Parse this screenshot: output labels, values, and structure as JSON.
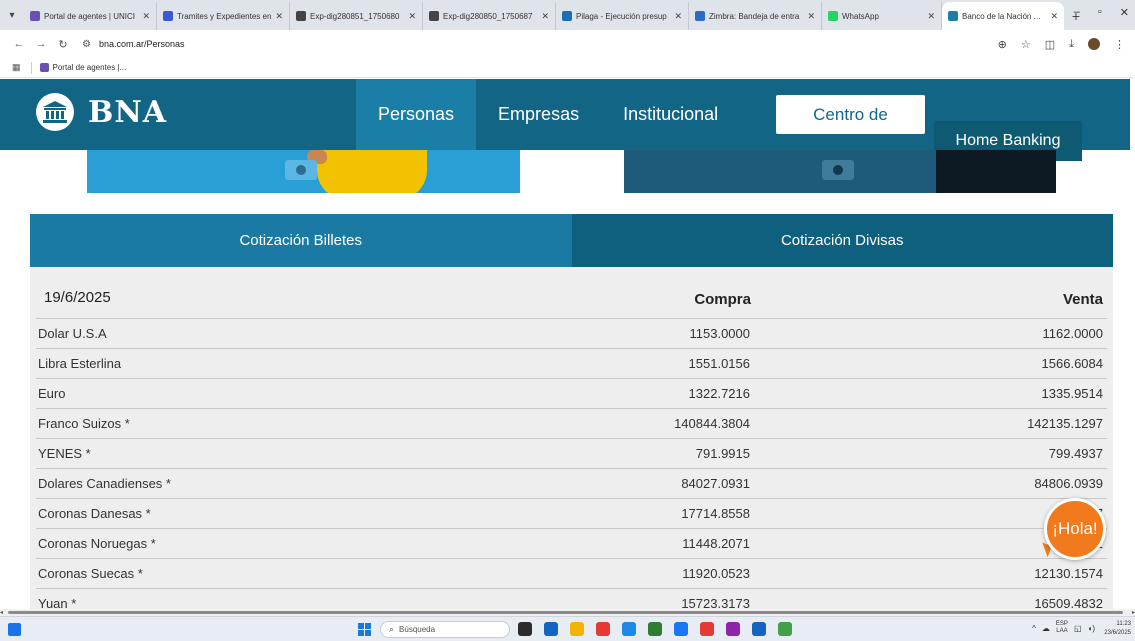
{
  "browser": {
    "tabs": [
      {
        "label": "Portal de agentes | UNICI",
        "color": "#6a4fb5"
      },
      {
        "label": "Tramites y Expedientes en",
        "color": "#3b5bd6"
      },
      {
        "label": "Exp-dig280851_1750680",
        "color": "#444444"
      },
      {
        "label": "Exp-dig280850_1750687",
        "color": "#444444"
      },
      {
        "label": "Pilaga - Ejecución presup",
        "color": "#1a6fb5"
      },
      {
        "label": "Zimbra: Bandeja de entra",
        "color": "#2b6cc4"
      },
      {
        "label": "WhatsApp",
        "color": "#25d366"
      },
      {
        "label": "Banco de la Nación Argen",
        "color": "#1b7ea6"
      }
    ],
    "url": "bna.com.ar/Personas",
    "bookmark": "Portal de agentes |..."
  },
  "site": {
    "logo_text": "BNA",
    "nav": [
      "Personas",
      "Empresas",
      "Institucional"
    ],
    "centro_label": "Centro de",
    "homebanking_label": "Home Banking"
  },
  "quotes": {
    "tab_billetes": "Cotización Billetes",
    "tab_divisas": "Cotización Divisas",
    "date": "19/6/2025",
    "compra_header": "Compra",
    "venta_header": "Venta",
    "rows": [
      {
        "name": "Dolar U.S.A",
        "compra": "1153.0000",
        "venta": "1162.0000"
      },
      {
        "name": "Libra Esterlina",
        "compra": "1551.0156",
        "venta": "1566.6084"
      },
      {
        "name": "Euro",
        "compra": "1322.7216",
        "venta": "1335.9514"
      },
      {
        "name": "Franco Suizos *",
        "compra": "140844.3804",
        "venta": "142135.1297"
      },
      {
        "name": "YENES *",
        "compra": "791.9915",
        "venta": "799.4937"
      },
      {
        "name": "Dolares Canadienses *",
        "compra": "84027.0931",
        "venta": "84806.0939"
      },
      {
        "name": "Coronas Danesas *",
        "compra": "17714.8558",
        "venta": "17"
      },
      {
        "name": "Coronas Noruegas *",
        "compra": "11448.2071",
        "venta": "11"
      },
      {
        "name": "Coronas Suecas *",
        "compra": "11920.0523",
        "venta": "12130.1574"
      },
      {
        "name": "Yuan *",
        "compra": "15723.3173",
        "venta": "16509.4832"
      }
    ]
  },
  "chat": {
    "label": "¡Hola!"
  },
  "taskbar": {
    "search_placeholder": "Búsqueda",
    "apps": [
      "#2b2b2b",
      "#1565c0",
      "#f2b400",
      "#e53935",
      "#1e88e5",
      "#2e7d32",
      "#1877f2",
      "#e53935",
      "#8e24aa",
      "#1565c0",
      "#43a047"
    ],
    "lang_top": "ESP",
    "lang_bottom": "LAA",
    "time": "11:23",
    "date": "23/6/2025"
  }
}
